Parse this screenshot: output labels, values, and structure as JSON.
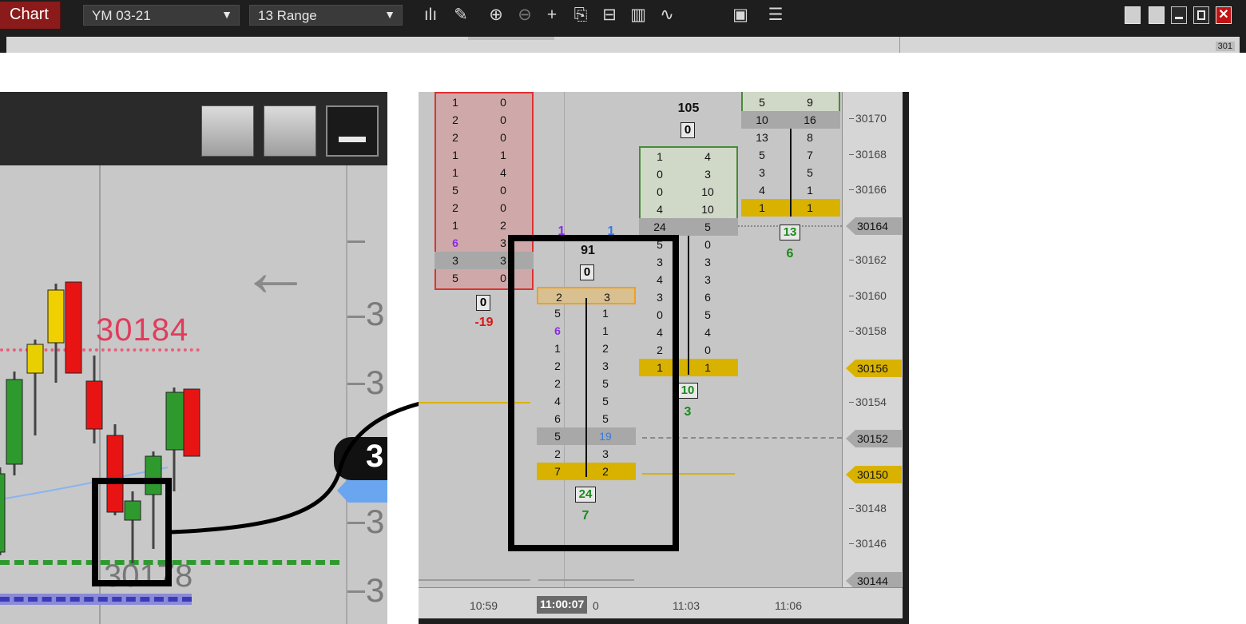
{
  "toolbar": {
    "chart_tab": "Chart",
    "instrument": "YM 03-21",
    "bar_type": "13 Range",
    "icons": [
      "bar-type-icon",
      "draw-icon",
      "zoom-in-icon",
      "zoom-out-icon",
      "crosshair-icon",
      "data-box-icon",
      "templates-icon",
      "indicators-icon",
      "strategies-icon",
      "properties-icon",
      "list-icon"
    ],
    "mini_price_tag": "301"
  },
  "left_panel": {
    "price_red": "30184",
    "price_gray": "30178",
    "axis_label": "3",
    "badge_label": "3",
    "arrow": "←"
  },
  "right_panel": {
    "price_levels": [
      "30170",
      "30168",
      "30166",
      "30164",
      "30162",
      "30160",
      "30158",
      "30156",
      "30154",
      "30152",
      "30150",
      "30148",
      "30146",
      "30144"
    ],
    "price_tags": [
      {
        "price": "30164",
        "style": "gray"
      },
      {
        "price": "30156",
        "style": "gold"
      },
      {
        "price": "30152",
        "style": "gray"
      },
      {
        "price": "30150",
        "style": "gold"
      },
      {
        "price": "30144",
        "style": "gray"
      }
    ],
    "time_labels": [
      "10:59",
      "11:03",
      "11:06"
    ],
    "time_highlight": "11:00:07",
    "time_suffix": "0",
    "bars": [
      {
        "name": "bar-1",
        "rows": [
          [
            "1",
            "0"
          ],
          [
            "2",
            "0"
          ],
          [
            "2",
            "0"
          ],
          [
            "1",
            "1"
          ],
          [
            "1",
            "4"
          ],
          [
            "5",
            "0"
          ],
          [
            "2",
            "0"
          ],
          [
            "1",
            "2"
          ],
          [
            "6",
            "3"
          ],
          [
            "3",
            "3"
          ],
          [
            "5",
            "0"
          ]
        ],
        "box": "0",
        "delta": "-19"
      },
      {
        "name": "bar-2",
        "total": "91",
        "box": "0",
        "rows": [
          [
            "2",
            "3"
          ],
          [
            "5",
            "1"
          ],
          [
            "6",
            "1"
          ],
          [
            "1",
            "2"
          ],
          [
            "2",
            "3"
          ],
          [
            "2",
            "5"
          ],
          [
            "4",
            "5"
          ],
          [
            "6",
            "5"
          ],
          [
            "5",
            "19"
          ],
          [
            "2",
            "3"
          ],
          [
            "7",
            "2"
          ]
        ],
        "box2": "24",
        "delta": "7",
        "top_hint": [
          "1",
          "1"
        ]
      },
      {
        "name": "bar-3",
        "total": "105",
        "box": "0",
        "rows": [
          [
            "1",
            "4"
          ],
          [
            "0",
            "3"
          ],
          [
            "0",
            "10"
          ],
          [
            "4",
            "10"
          ],
          [
            "24",
            "5"
          ],
          [
            "5",
            "0"
          ],
          [
            "3",
            "3"
          ],
          [
            "4",
            "3"
          ],
          [
            "3",
            "6"
          ],
          [
            "0",
            "5"
          ],
          [
            "4",
            "4"
          ],
          [
            "2",
            "0"
          ],
          [
            "1",
            "1"
          ]
        ],
        "box2": "10",
        "delta": "3"
      },
      {
        "name": "bar-4",
        "rows": [
          [
            "5",
            "9"
          ],
          [
            "10",
            "16"
          ],
          [
            "13",
            "8"
          ],
          [
            "5",
            "7"
          ],
          [
            "3",
            "5"
          ],
          [
            "4",
            "1"
          ],
          [
            "1",
            "1"
          ]
        ],
        "box2": "13",
        "delta": "6"
      }
    ]
  }
}
